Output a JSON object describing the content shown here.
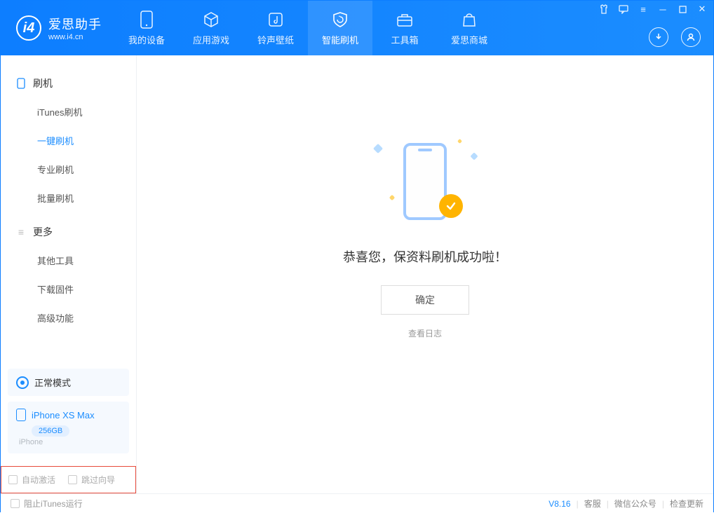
{
  "brand": {
    "name": "爱思助手",
    "url": "www.i4.cn"
  },
  "nav": {
    "mydevice": "我的设备",
    "apps": "应用游戏",
    "ring": "铃声壁纸",
    "flash": "智能刷机",
    "tools": "工具箱",
    "store": "爱思商城"
  },
  "sidebar": {
    "group1": {
      "title": "刷机",
      "items": {
        "itunes": "iTunes刷机",
        "oneclick": "一键刷机",
        "pro": "专业刷机",
        "batch": "批量刷机"
      }
    },
    "group2": {
      "title": "更多",
      "items": {
        "other": "其他工具",
        "firmware": "下载固件",
        "advanced": "高级功能"
      }
    }
  },
  "mode": {
    "label": "正常模式"
  },
  "device": {
    "name": "iPhone XS Max",
    "capacity": "256GB",
    "type": "iPhone"
  },
  "options": {
    "auto_activate": "自动激活",
    "skip_guide": "跳过向导"
  },
  "main": {
    "message": "恭喜您，保资料刷机成功啦！",
    "ok": "确定",
    "view_log": "查看日志"
  },
  "footer": {
    "block_itunes": "阻止iTunes运行",
    "version": "V8.16",
    "support": "客服",
    "wechat": "微信公众号",
    "update": "检查更新"
  }
}
